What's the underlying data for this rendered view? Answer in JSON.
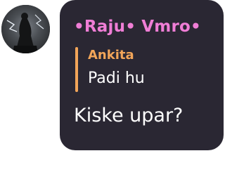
{
  "avatar": {
    "icon": "profile-avatar"
  },
  "message": {
    "sender": "•Raju• Vmro•",
    "reply": {
      "author": "Ankita",
      "text": "Padi hu"
    },
    "text": "Kiske upar?"
  },
  "colors": {
    "bubble": "#2a2733",
    "sender": "#f07ed6",
    "reply_accent": "#f2a559",
    "text": "#ffffff"
  }
}
